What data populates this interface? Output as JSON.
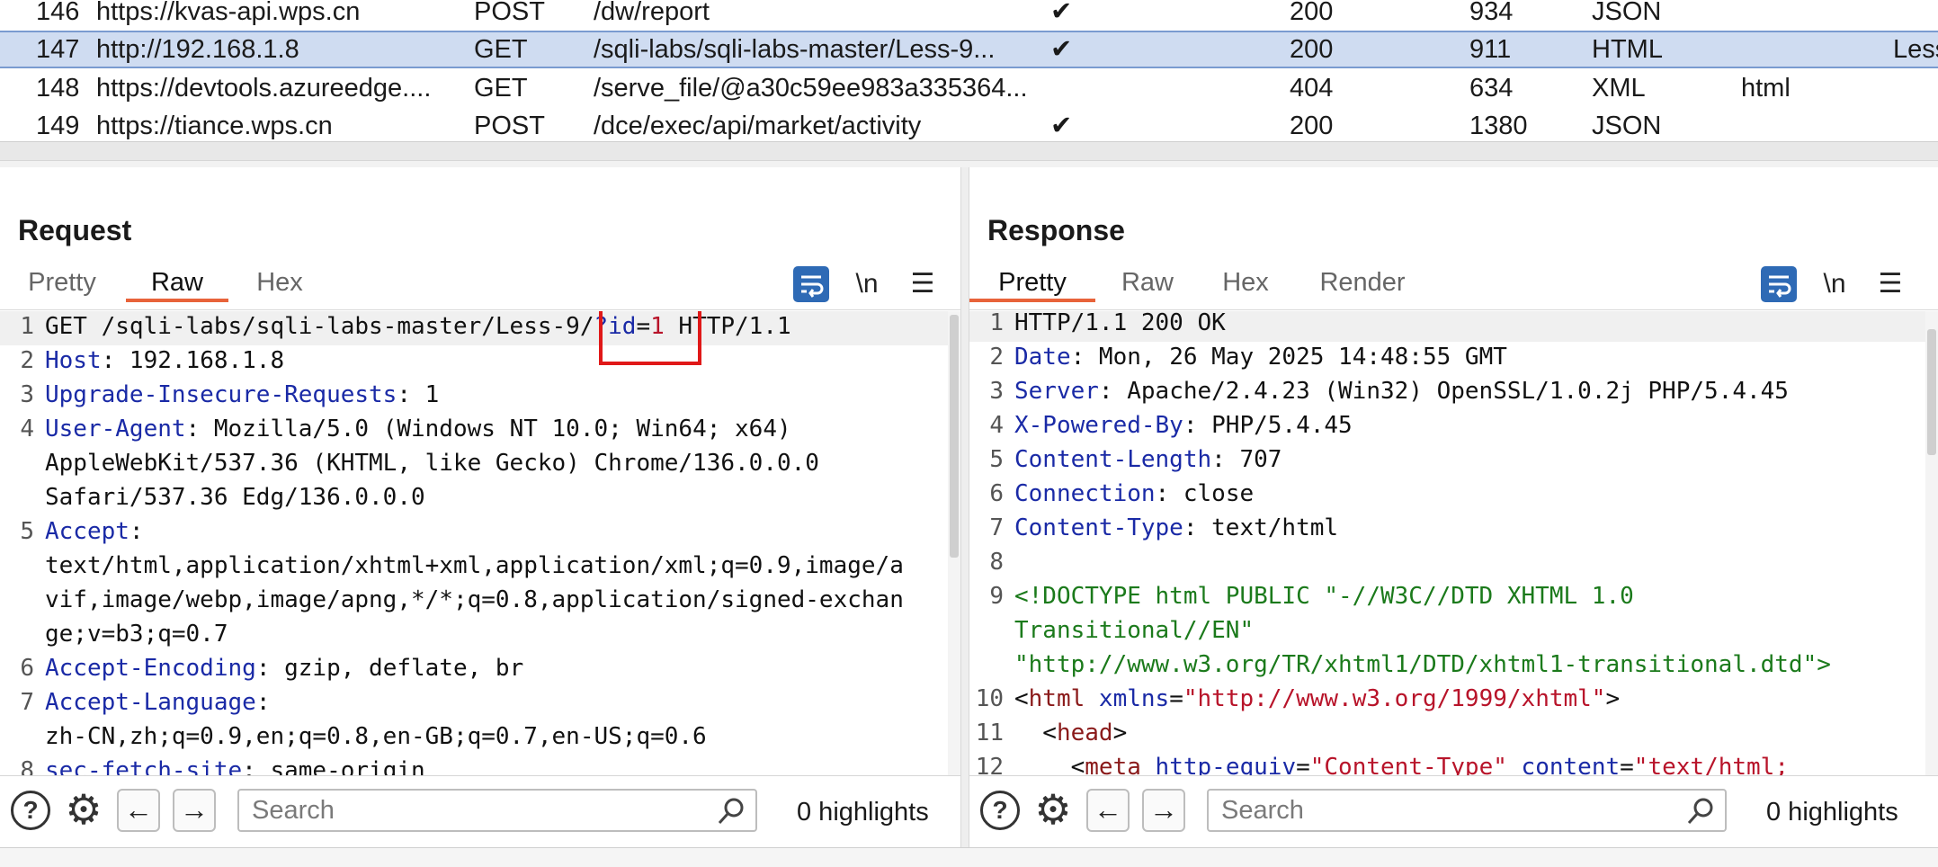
{
  "history": {
    "rows": [
      {
        "num": "146",
        "host": "https://kvas-api.wps.cn",
        "method": "POST",
        "url": "/dw/report",
        "params": "✔",
        "status": "200",
        "length": "934",
        "mime": "JSON",
        "ext": "",
        "title": ""
      },
      {
        "num": "147",
        "host": "http://192.168.1.8",
        "method": "GET",
        "url": "/sqli-labs/sqli-labs-master/Less-9...",
        "params": "✔",
        "status": "200",
        "length": "911",
        "mime": "HTML",
        "ext": "",
        "title": "Less"
      },
      {
        "num": "148",
        "host": "https://devtools.azureedge....",
        "method": "GET",
        "url": "/serve_file/@a30c59ee983a335364...",
        "params": "",
        "status": "404",
        "length": "634",
        "mime": "XML",
        "ext": "html",
        "title": ""
      },
      {
        "num": "149",
        "host": "https://tiance.wps.cn",
        "method": "POST",
        "url": "/dce/exec/api/market/activity",
        "params": "✔",
        "status": "200",
        "length": "1380",
        "mime": "JSON",
        "ext": "",
        "title": ""
      }
    ]
  },
  "request": {
    "title": "Request",
    "tabs": [
      "Pretty",
      "Raw",
      "Hex"
    ],
    "active_tab": "Raw",
    "newline_label": "\\n",
    "lines": {
      "l1a": "GET /sqli-labs/sqli-labs-master/Less-9/",
      "l1b": "?",
      "l1c": "id",
      "l1d": "=",
      "l1e": "1",
      "l1f": " HTTP/1.1",
      "l2k": "Host",
      "l2v": ": 192.168.1.8",
      "l3k": "Upgrade-Insecure-Requests",
      "l3v": ": 1",
      "l4k": "User-Agent",
      "l4v": ": Mozilla/5.0 (Windows NT 10.0; Win64; x64)",
      "l4b": "AppleWebKit/537.36 (KHTML, like Gecko) Chrome/136.0.0.0",
      "l4c": "Safari/537.36 Edg/136.0.0.0",
      "l5k": "Accept",
      "l5v": ":",
      "l5b": "text/html,application/xhtml+xml,application/xml;q=0.9,image/a",
      "l5c": "vif,image/webp,image/apng,*/*;q=0.8,application/signed-exchan",
      "l5d": "ge;v=b3;q=0.7",
      "l6k": "Accept-Encoding",
      "l6v": ": gzip, deflate, br",
      "l7k": "Accept-Language",
      "l7v": ":",
      "l7b": "zh-CN,zh;q=0.9,en;q=0.8,en-GB;q=0.7,en-US;q=0.6",
      "l8k": "sec-fetch-site",
      "l8v": ": same-origin"
    },
    "search_placeholder": "Search",
    "highlights": "0 highlights"
  },
  "response": {
    "title": "Response",
    "tabs": [
      "Pretty",
      "Raw",
      "Hex",
      "Render"
    ],
    "active_tab": "Pretty",
    "newline_label": "\\n",
    "lines": {
      "l1": "HTTP/1.1 200 OK",
      "l2k": "Date",
      "l2v": ": Mon, 26 May 2025 14:48:55 GMT",
      "l3k": "Server",
      "l3v": ": Apache/2.4.23 (Win32) OpenSSL/1.0.2j PHP/5.4.45",
      "l4k": "X-Powered-By",
      "l4v": ": PHP/5.4.45",
      "l5k": "Content-Length",
      "l5v": ": 707",
      "l6k": "Connection",
      "l6v": ": close",
      "l7k": "Content-Type",
      "l7v": ": text/html",
      "l9a": "<!DOCTYPE html PUBLIC \"-//W3C//DTD XHTML 1.0",
      "l9b": "Transitional//EN\"",
      "l9c": "\"http://www.w3.org/TR/xhtml1/DTD/xhtml1-transitional.dtd\">",
      "l10a": "<",
      "l10b": "html",
      "l10c": " xmlns",
      "l10d": "=",
      "l10e": "\"http://www.w3.org/1999/xhtml\"",
      "l10f": ">",
      "l11a": "  <",
      "l11b": "head",
      "l11c": ">",
      "l12a": "    <",
      "l12b": "meta",
      "l12c": " http-equiv",
      "l12d": "=",
      "l12e": "\"Content-Type\"",
      "l12f": " content",
      "l12g": "=",
      "l12h": "\"text/html;"
    },
    "search_placeholder": "Search",
    "highlights": "0 highlights"
  },
  "colors": {
    "accent": "#2e6ab5",
    "active_tab_underline": "#e8633a",
    "highlight_box": "#e01818",
    "selected_row": "#cfdcf1"
  }
}
